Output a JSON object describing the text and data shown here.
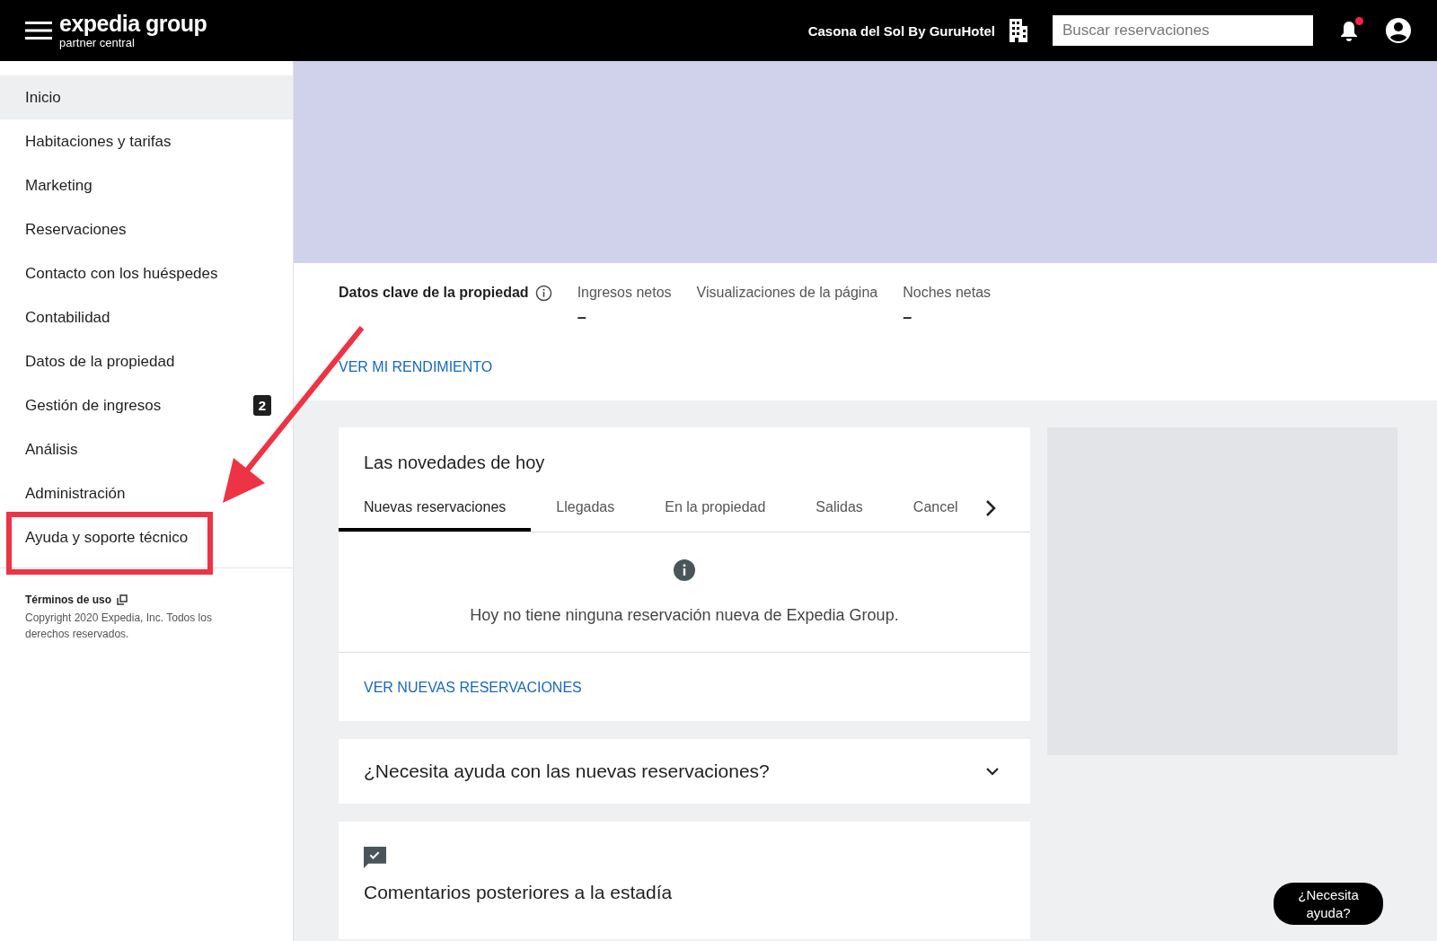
{
  "header": {
    "logo_main": "expedia group",
    "logo_sub": "partner central",
    "property": "Casona del Sol By GuruHotel",
    "search": {
      "placeholder": "Buscar reservaciones"
    },
    "notification_dot": true
  },
  "sidebar": {
    "items": [
      {
        "label": "Inicio",
        "selected": true
      },
      {
        "label": "Habitaciones y tarifas",
        "selected": false
      },
      {
        "label": "Marketing",
        "selected": false
      },
      {
        "label": "Reservaciones",
        "selected": false
      },
      {
        "label": "Contacto con los huéspedes",
        "selected": false
      },
      {
        "label": "Contabilidad",
        "selected": false
      },
      {
        "label": "Datos de la propiedad",
        "selected": false
      },
      {
        "label": "Gestión de ingresos",
        "selected": false,
        "badge": "2"
      },
      {
        "label": "Análisis",
        "selected": false
      },
      {
        "label": "Administración",
        "selected": false
      },
      {
        "label": "Ayuda y soporte técnico",
        "selected": false,
        "highlighted": true
      }
    ],
    "terms": "Términos de uso",
    "copyright": "Copyright 2020 Expedia, Inc. Todos los derechos reservados."
  },
  "key_data": {
    "title": "Datos clave de la propiedad",
    "metrics": [
      {
        "label": "Ingresos netos",
        "value": "–"
      },
      {
        "label": "Visualizaciones de la página"
      },
      {
        "label": "Noches netas",
        "value": "–"
      }
    ],
    "link": "VER MI RENDIMIENTO"
  },
  "today": {
    "title": "Las novedades de hoy",
    "tabs": [
      {
        "label": "Nuevas reservaciones",
        "selected": true
      },
      {
        "label": "Llegadas",
        "selected": false
      },
      {
        "label": "En la propiedad",
        "selected": false
      },
      {
        "label": "Salidas",
        "selected": false
      },
      {
        "label": "Cancel",
        "selected": false
      }
    ],
    "message": "Hoy no tiene ninguna reservación nueva de Expedia Group.",
    "link": "VER NUEVAS RESERVACIONES"
  },
  "help_panel": {
    "title": "¿Necesita ayuda con las nuevas reservaciones?",
    "expanded": false
  },
  "feedback": {
    "title": "Comentarios posteriores a la estadía"
  },
  "help_button": "¿Necesita ayuda?"
}
